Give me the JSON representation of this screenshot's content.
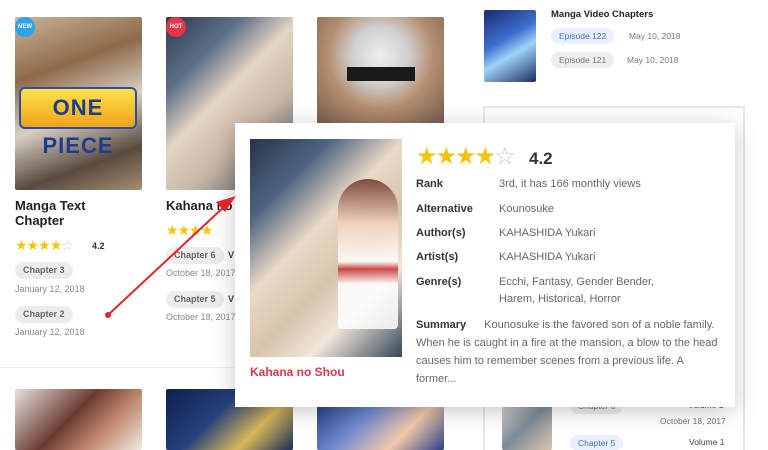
{
  "grid": {
    "card1": {
      "badge": "NEW",
      "cover_text": "ONE PIECE",
      "title_line1": "Manga Text",
      "title_line2": "Chapter",
      "rating": "4.2",
      "chapters": [
        {
          "label": "Chapter 3",
          "date": "January 12, 2018"
        },
        {
          "label": "Chapter 2",
          "date": "January 12, 2018"
        }
      ]
    },
    "card2": {
      "badge": "HOT",
      "title": "Kahana no",
      "rating_tail": "",
      "chapters": [
        {
          "label": "Chapter 6",
          "date": "October 18, 2017",
          "suffix": "V"
        },
        {
          "label": "Chapter 5",
          "date": "October 18, 2017",
          "suffix": "V"
        }
      ]
    }
  },
  "sidebar": {
    "video_title": "Manga Video Chapters",
    "episodes": [
      {
        "label": "Episode 122",
        "date": "May 10, 2018"
      },
      {
        "label": "Episode 121",
        "date": "May 10, 2018"
      }
    ],
    "list": [
      {
        "chapter": "Chapter 6",
        "volume": "Volume 1",
        "date": "October 18, 2017"
      },
      {
        "chapter": "Chapter 5",
        "volume": "Volume 1"
      }
    ]
  },
  "popup": {
    "rating": "4.2",
    "stars_filled": 4,
    "title": "Kahana no Shou",
    "fields": [
      {
        "label": "Rank",
        "value": "3rd, it has 166 monthly views"
      },
      {
        "label": "Alternative",
        "value": "Kounosuke"
      },
      {
        "label": "Author(s)",
        "value": "KAHASHIDA Yukari"
      },
      {
        "label": "Artist(s)",
        "value": "KAHASHIDA Yukari"
      },
      {
        "label": "Genre(s)",
        "value_line1": "Ecchi,  Fantasy,  Gender Bender,",
        "value_line2": "Harem,  Historical,  Horror"
      }
    ],
    "summary_label": "Summary",
    "summary_text": "Kounosuke is the favored son of a noble family. When he is caught in a fire at the mansion, a blow to the head causes him to remember scenes from a previous life. A former..."
  },
  "colors": {
    "star": "#f4c30d",
    "accent_red": "#e2334b",
    "badge_new": "#2aa6e8",
    "badge_hot": "#e8344a",
    "link_blue": "#3b6fd8"
  }
}
